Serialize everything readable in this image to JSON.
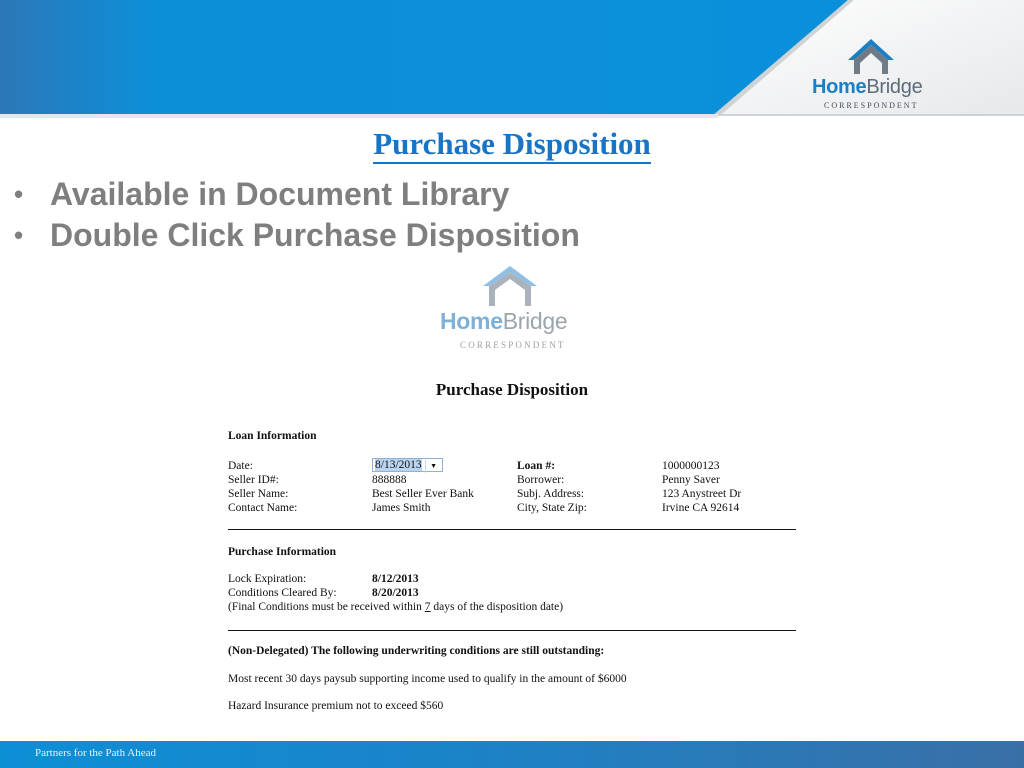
{
  "brand": {
    "name_a": "Home",
    "name_b": "Bridge",
    "tagline": "CORRESPONDENT"
  },
  "slide": {
    "title": "Purchase Disposition",
    "bullets": [
      "Available in Document Library",
      "Double Click Purchase Disposition"
    ]
  },
  "document": {
    "title": "Purchase Disposition",
    "loan_info": {
      "heading": "Loan Information",
      "rows": [
        {
          "l1": "Date:",
          "v1": "8/13/2013",
          "l2": "Loan #:",
          "v2": "1000000123"
        },
        {
          "l1": "Seller ID#:",
          "v1": "888888",
          "l2": "Borrower:",
          "v2": "Penny Saver"
        },
        {
          "l1": "Seller Name:",
          "v1": "Best Seller Ever Bank",
          "l2": "Subj. Address:",
          "v2": "123 Anystreet Dr"
        },
        {
          "l1": "Contact Name:",
          "v1": "James Smith",
          "l2": "City, State  Zip:",
          "v2": "Irvine CA 92614"
        }
      ]
    },
    "purchase_info": {
      "heading": "Purchase Information",
      "lock_label": "Lock Expiration:",
      "lock_value": "8/12/2013",
      "cleared_label": "Conditions Cleared By:",
      "cleared_value": "8/20/2013",
      "note_before": "(Final Conditions must be received within ",
      "note_days": "7",
      "note_after": " days of the disposition date)"
    },
    "conditions": {
      "heading": "(Non-Delegated) The following underwriting conditions are still outstanding:",
      "items": [
        "Most recent 30 days paysub supporting income used to qualify  in the amount of $6000",
        "Hazard Insurance premium not to exceed $560"
      ]
    }
  },
  "footer": {
    "text": "Partners for the Path Ahead"
  },
  "colors": {
    "accent": "#1874c5",
    "header_blue": "#0a8fd6",
    "footer_blue": "#1b83c8",
    "bullet_gray": "#7f7f7f"
  }
}
